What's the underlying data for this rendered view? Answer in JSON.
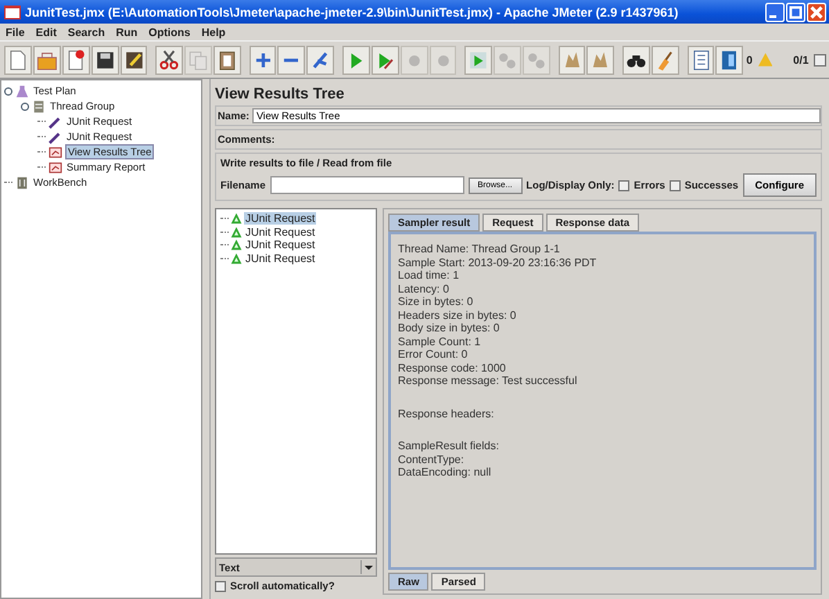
{
  "window": {
    "title": "JunitTest.jmx (E:\\AutomationTools\\Jmeter\\apache-jmeter-2.9\\bin\\JunitTest.jmx) - Apache JMeter (2.9 r1437961)"
  },
  "menu": [
    "File",
    "Edit",
    "Search",
    "Run",
    "Options",
    "Help"
  ],
  "toolbar": [
    {
      "kind": "new",
      "disabled": false
    },
    {
      "kind": "open",
      "disabled": false
    },
    {
      "kind": "templates",
      "disabled": false
    },
    {
      "kind": "save",
      "disabled": false
    },
    {
      "kind": "save-as",
      "disabled": false
    },
    {
      "kind": "sep"
    },
    {
      "kind": "cut",
      "disabled": false
    },
    {
      "kind": "copy",
      "disabled": true
    },
    {
      "kind": "paste",
      "disabled": false
    },
    {
      "kind": "sep"
    },
    {
      "kind": "expand",
      "disabled": false
    },
    {
      "kind": "collapse",
      "disabled": false
    },
    {
      "kind": "toggle",
      "disabled": false
    },
    {
      "kind": "sep"
    },
    {
      "kind": "start",
      "disabled": false
    },
    {
      "kind": "start-no-pause",
      "disabled": false
    },
    {
      "kind": "stop",
      "disabled": true
    },
    {
      "kind": "shutdown",
      "disabled": true
    },
    {
      "kind": "sep"
    },
    {
      "kind": "remote-start",
      "disabled": false
    },
    {
      "kind": "remote-stop",
      "disabled": true
    },
    {
      "kind": "remote-shutdown",
      "disabled": true
    },
    {
      "kind": "sep"
    },
    {
      "kind": "clear",
      "disabled": false
    },
    {
      "kind": "clear-all",
      "disabled": false
    },
    {
      "kind": "sep"
    },
    {
      "kind": "search",
      "disabled": false
    },
    {
      "kind": "reset-search",
      "disabled": false
    },
    {
      "kind": "sep"
    },
    {
      "kind": "function",
      "disabled": false
    },
    {
      "kind": "help",
      "disabled": false
    }
  ],
  "status": {
    "warnings": "0",
    "threads": "0/1"
  },
  "tree": [
    {
      "label": "Test Plan",
      "kind": "plan",
      "selected": false,
      "children": [
        {
          "label": "Thread Group",
          "kind": "thread-group",
          "selected": false,
          "children": [
            {
              "label": "JUnit Request",
              "kind": "sampler",
              "selected": false
            },
            {
              "label": "JUnit Request",
              "kind": "sampler",
              "selected": false
            },
            {
              "label": "View Results Tree",
              "kind": "listener",
              "selected": true
            },
            {
              "label": "Summary Report",
              "kind": "listener",
              "selected": false
            }
          ]
        }
      ]
    },
    {
      "label": "WorkBench",
      "kind": "workbench",
      "selected": false
    }
  ],
  "panel": {
    "title": "View Results Tree",
    "name_label": "Name:",
    "name_value": "View Results Tree",
    "comments_label": "Comments:",
    "file_group": {
      "title": "Write results to file / Read from file",
      "filename_label": "Filename",
      "browse": "Browse...",
      "log_label": "Log/Display Only:",
      "options": [
        {
          "label": "Errors",
          "checked": false
        },
        {
          "label": "Successes",
          "checked": false
        }
      ],
      "configure": "Configure"
    },
    "results": [
      {
        "label": "JUnit Request",
        "selected": true
      },
      {
        "label": "JUnit Request",
        "selected": false
      },
      {
        "label": "JUnit Request",
        "selected": false
      },
      {
        "label": "JUnit Request",
        "selected": false
      }
    ],
    "renderer": "Text",
    "scroll_label": "Scroll automatically?",
    "scroll_checked": false,
    "tabs": [
      {
        "label": "Sampler result",
        "selected": true
      },
      {
        "label": "Request",
        "selected": false
      },
      {
        "label": "Response data",
        "selected": false
      }
    ],
    "sections": [
      {
        "lines": [
          "Thread Name: Thread Group 1-1",
          "Sample Start: 2013-09-20 23:16:36 PDT",
          "Load time: 1",
          "Latency: 0",
          "Size in bytes: 0",
          "Headers size in bytes: 0",
          "Body size in bytes: 0",
          "Sample Count: 1",
          "Error Count: 0",
          "Response code: 1000",
          "Response message: Test successful"
        ]
      },
      {
        "lines": [
          "Response headers:"
        ]
      },
      {
        "lines": [
          "SampleResult fields:",
          "ContentType:",
          "DataEncoding: null"
        ]
      }
    ],
    "bottom_tabs": [
      {
        "label": "Raw",
        "selected": true
      },
      {
        "label": "Parsed",
        "selected": false
      }
    ]
  }
}
